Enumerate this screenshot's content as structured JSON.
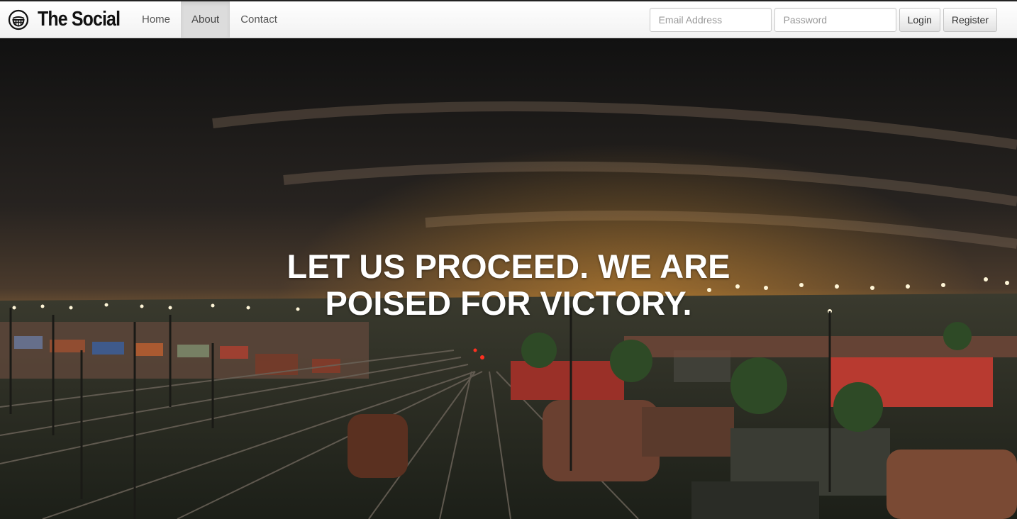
{
  "brand": {
    "name": "The Social",
    "icon": "grinning-face-icon"
  },
  "nav": {
    "items": [
      {
        "label": "Home",
        "active": false
      },
      {
        "label": "About",
        "active": true
      },
      {
        "label": "Contact",
        "active": false
      }
    ]
  },
  "login": {
    "email_placeholder": "Email Address",
    "password_placeholder": "Password",
    "login_label": "Login",
    "register_label": "Register"
  },
  "hero": {
    "headline_line1": "LET US PROCEED. WE ARE",
    "headline_line2": "POISED FOR VICTORY.",
    "background": "night-rail-yard-photo"
  }
}
